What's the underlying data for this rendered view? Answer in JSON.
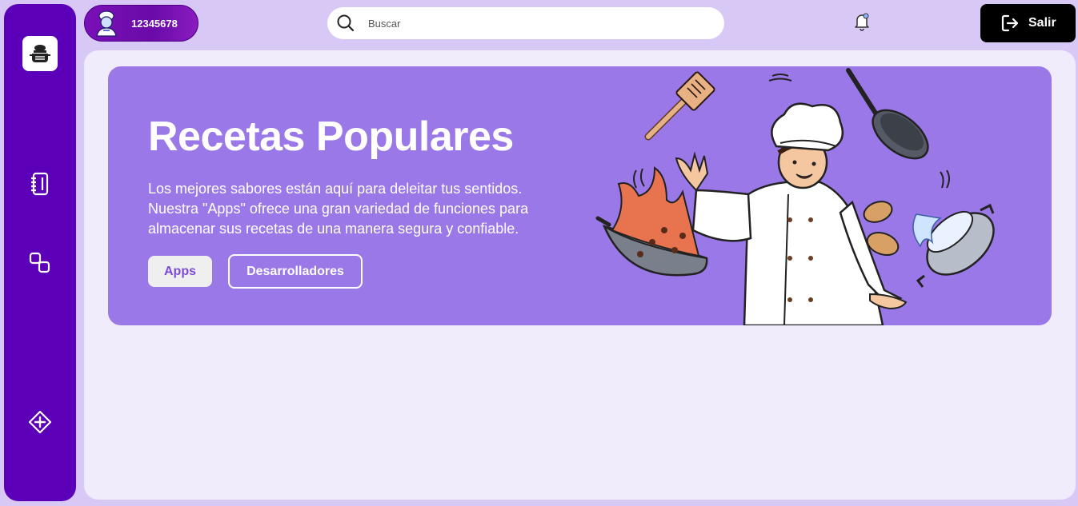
{
  "sidebar": {
    "logo_icon": "chef-pot-logo-icon",
    "items": [
      {
        "icon": "notebook-icon"
      },
      {
        "icon": "link-squares-icon"
      },
      {
        "icon": "add-diamond-icon"
      }
    ]
  },
  "header": {
    "user_id": "12345678",
    "avatar_icon": "chef-avatar-icon",
    "search_placeholder": "Buscar",
    "search_value": "",
    "bell_icon": "bell-icon",
    "logout_label": "Salir",
    "logout_icon": "logout-icon"
  },
  "hero": {
    "title": "Recetas Populares",
    "description": "Los mejores sabores están aquí para deleitar tus sentidos. Nuestra \"Apps\" ofrece una gran variedad de funciones para almacenar sus recetas de una manera segura y confiable.",
    "buttons": {
      "apps": "Apps",
      "developers": "Desarrolladores"
    },
    "illustration": "chef-cooking-illustration"
  },
  "colors": {
    "sidebar": "#5b00b8",
    "background": "#d8c8f5",
    "main_panel": "#f1ecfb",
    "hero": "#9b78e8",
    "logout": "#000000",
    "accent_text": "#7b4bd8"
  }
}
